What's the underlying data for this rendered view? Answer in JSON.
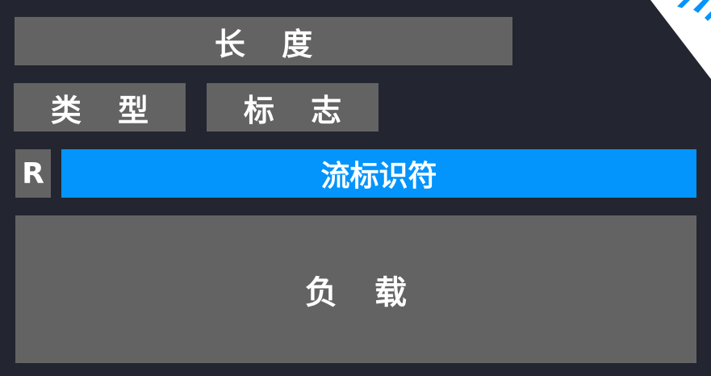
{
  "fields": {
    "length": "长 度",
    "type": "类 型",
    "flag": "标 志",
    "r": "R",
    "flow_id": "流标识符",
    "payload": "负 载"
  },
  "colors": {
    "background": "#232530",
    "field_gray": "#636363",
    "field_blue": "#0394fc",
    "corner_white": "#ffffff",
    "corner_blue": "#0394fc"
  }
}
